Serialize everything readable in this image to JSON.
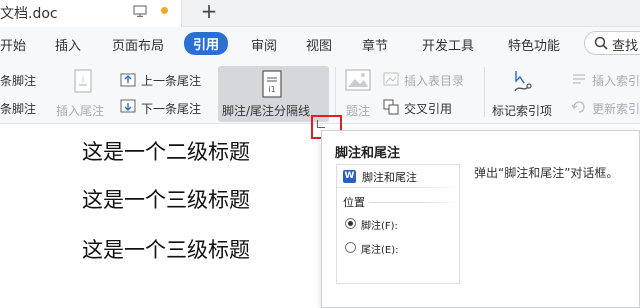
{
  "titlebar": {
    "doc_title": "文档.doc",
    "new_tab_label": "+"
  },
  "menu": {
    "items": [
      "开始",
      "插入",
      "页面布局",
      "引用",
      "审阅",
      "视图",
      "章节",
      "开发工具",
      "特色功能"
    ],
    "active": "引用",
    "search_label": "查找"
  },
  "ribbon": {
    "insert_footnote_top": "条脚注",
    "insert_footnote_bottom": "条脚注",
    "insert_endnote": "插入尾注",
    "prev_endnote": "上一条尾注",
    "next_endnote": "下一条尾注",
    "footnote_separator": "脚注/尾注分隔线",
    "caption": "题注",
    "insert_table_of_figures": "插入表目录",
    "cross_reference": "交叉引用",
    "mark_index_entry": "标记索引项",
    "insert_index": "插入索引",
    "update_index": "更新索引"
  },
  "document": {
    "headings": [
      "这是一个二级标题",
      "这是一个三级标题",
      "这是一个三级标题"
    ]
  },
  "tooltip": {
    "title": "脚注和尾注",
    "description": "弹出“脚注和尾注”对话框。",
    "preview": {
      "dialog_title": "脚注和尾注",
      "group_label": "位置",
      "option_footnote": "脚注(F):",
      "option_endnote": "尾注(E):"
    }
  },
  "colors": {
    "accent": "#2b6fd1",
    "highlight_box": "#e02020",
    "tab_dot": "#f5a623"
  }
}
